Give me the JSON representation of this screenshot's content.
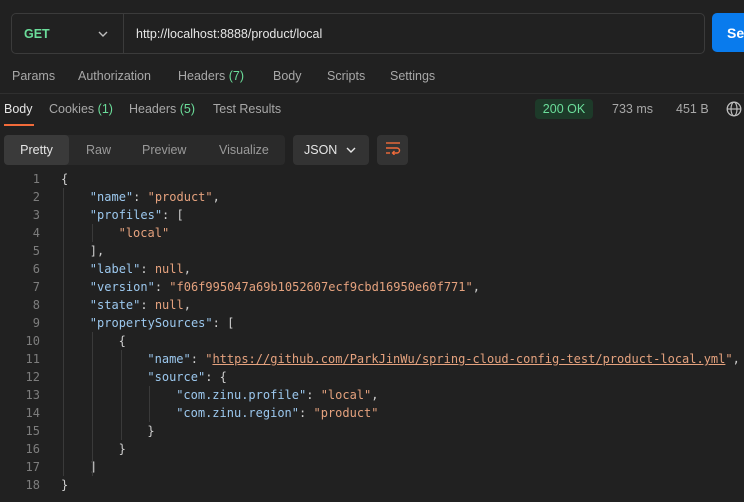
{
  "request": {
    "method": "GET",
    "url": "http://localhost:8888/product/local",
    "send_label": "Se"
  },
  "request_tabs": [
    {
      "label": "Params",
      "count": ""
    },
    {
      "label": "Authorization",
      "count": ""
    },
    {
      "label": "Headers",
      "count": "(7)"
    },
    {
      "label": "Body",
      "count": ""
    },
    {
      "label": "Scripts",
      "count": ""
    },
    {
      "label": "Settings",
      "count": ""
    }
  ],
  "response_tabs": [
    {
      "label": "Body",
      "count": ""
    },
    {
      "label": "Cookies",
      "count": "(1)"
    },
    {
      "label": "Headers",
      "count": "(5)"
    },
    {
      "label": "Test Results",
      "count": ""
    }
  ],
  "response_meta": {
    "status": "200 OK",
    "time": "733 ms",
    "size": "451 B"
  },
  "view_modes": [
    "Pretty",
    "Raw",
    "Preview",
    "Visualize"
  ],
  "format": "JSON",
  "code_lines": [
    {
      "n": "1",
      "indent": 0,
      "parts": [
        {
          "t": "p",
          "v": "{"
        }
      ]
    },
    {
      "n": "2",
      "indent": 1,
      "parts": [
        {
          "t": "key",
          "v": "\"name\""
        },
        {
          "t": "p",
          "v": ": "
        },
        {
          "t": "str",
          "v": "\"product\""
        },
        {
          "t": "p",
          "v": ","
        }
      ]
    },
    {
      "n": "3",
      "indent": 1,
      "parts": [
        {
          "t": "key",
          "v": "\"profiles\""
        },
        {
          "t": "p",
          "v": ": ["
        }
      ]
    },
    {
      "n": "4",
      "indent": 2,
      "parts": [
        {
          "t": "str",
          "v": "\"local\""
        }
      ]
    },
    {
      "n": "5",
      "indent": 1,
      "parts": [
        {
          "t": "p",
          "v": "],"
        }
      ]
    },
    {
      "n": "6",
      "indent": 1,
      "parts": [
        {
          "t": "key",
          "v": "\"label\""
        },
        {
          "t": "p",
          "v": ": "
        },
        {
          "t": "lit",
          "v": "null"
        },
        {
          "t": "p",
          "v": ","
        }
      ]
    },
    {
      "n": "7",
      "indent": 1,
      "parts": [
        {
          "t": "key",
          "v": "\"version\""
        },
        {
          "t": "p",
          "v": ": "
        },
        {
          "t": "str",
          "v": "\"f06f995047a69b1052607ecf9cbd16950e60f771\""
        },
        {
          "t": "p",
          "v": ","
        }
      ]
    },
    {
      "n": "8",
      "indent": 1,
      "parts": [
        {
          "t": "key",
          "v": "\"state\""
        },
        {
          "t": "p",
          "v": ": "
        },
        {
          "t": "lit",
          "v": "null"
        },
        {
          "t": "p",
          "v": ","
        }
      ]
    },
    {
      "n": "9",
      "indent": 1,
      "parts": [
        {
          "t": "key",
          "v": "\"propertySources\""
        },
        {
          "t": "p",
          "v": ": ["
        }
      ]
    },
    {
      "n": "10",
      "indent": 2,
      "parts": [
        {
          "t": "p",
          "v": "{"
        }
      ]
    },
    {
      "n": "11",
      "indent": 3,
      "parts": [
        {
          "t": "key",
          "v": "\"name\""
        },
        {
          "t": "p",
          "v": ": "
        },
        {
          "t": "str",
          "v": "\""
        },
        {
          "t": "link",
          "v": "https://github.com/ParkJinWu/spring-cloud-config-test/product-local.yml"
        },
        {
          "t": "str",
          "v": "\""
        },
        {
          "t": "p",
          "v": ","
        }
      ]
    },
    {
      "n": "12",
      "indent": 3,
      "parts": [
        {
          "t": "key",
          "v": "\"source\""
        },
        {
          "t": "p",
          "v": ": {"
        }
      ]
    },
    {
      "n": "13",
      "indent": 4,
      "parts": [
        {
          "t": "key",
          "v": "\"com.zinu.profile\""
        },
        {
          "t": "p",
          "v": ": "
        },
        {
          "t": "str",
          "v": "\"local\""
        },
        {
          "t": "p",
          "v": ","
        }
      ]
    },
    {
      "n": "14",
      "indent": 4,
      "parts": [
        {
          "t": "key",
          "v": "\"com.zinu.region\""
        },
        {
          "t": "p",
          "v": ": "
        },
        {
          "t": "str",
          "v": "\"product\""
        }
      ]
    },
    {
      "n": "15",
      "indent": 3,
      "parts": [
        {
          "t": "p",
          "v": "}"
        }
      ]
    },
    {
      "n": "16",
      "indent": 2,
      "parts": [
        {
          "t": "p",
          "v": "}"
        }
      ]
    },
    {
      "n": "17",
      "indent": 1,
      "parts": [
        {
          "t": "p",
          "v": "]"
        }
      ]
    },
    {
      "n": "18",
      "indent": 0,
      "parts": [
        {
          "t": "p",
          "v": "}"
        }
      ]
    }
  ],
  "colors": {
    "accent": "#f26b3a",
    "send": "#097bed",
    "status_ok": "#6bdd9a",
    "key": "#9cc8ee",
    "string": "#e5a27e"
  },
  "icons": [
    "chevron-down-icon",
    "globe-icon",
    "wrap-lines-icon"
  ]
}
